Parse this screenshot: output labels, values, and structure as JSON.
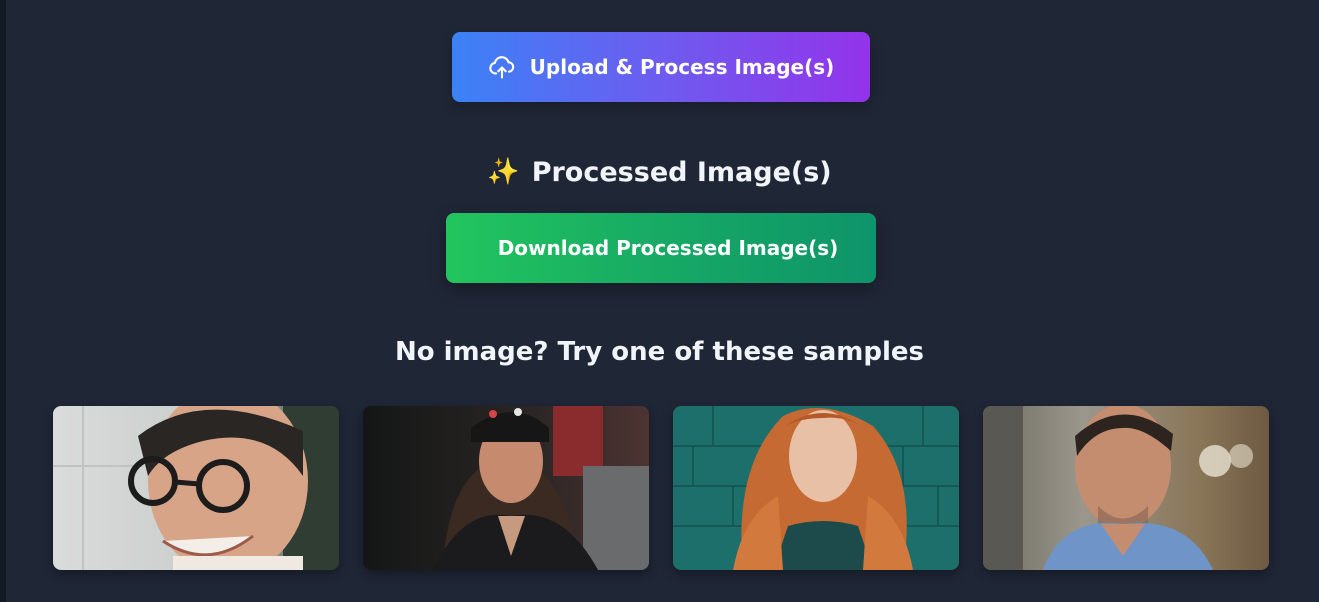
{
  "upload": {
    "label": "Upload & Process Image(s)",
    "icon": "cloud-upload-icon"
  },
  "processed": {
    "icon": "sparkles-icon",
    "icon_glyph": "✨",
    "title": "Processed Image(s)"
  },
  "download": {
    "label": "Download Processed Image(s)"
  },
  "samples": {
    "title": "No image? Try one of these samples",
    "items": [
      {
        "name": "sample-man-glasses-smiling"
      },
      {
        "name": "sample-woman-beanie-leather-jacket"
      },
      {
        "name": "sample-redhead-woman-teal-wall"
      },
      {
        "name": "sample-man-blue-shirt"
      }
    ]
  },
  "colors": {
    "background": "#1f2636",
    "upload_gradient": [
      "#3b82f6",
      "#9333ea"
    ],
    "download_gradient": [
      "#22c55e",
      "#0e946a"
    ],
    "text": "#f1f5f9"
  }
}
